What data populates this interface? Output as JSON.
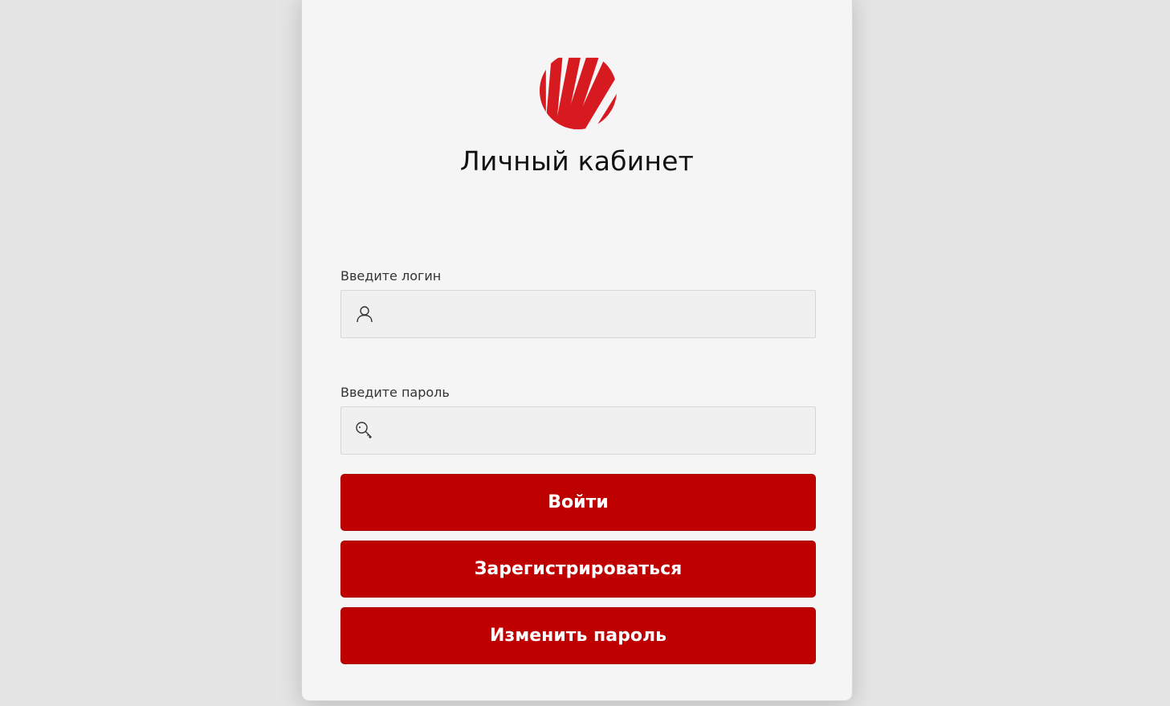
{
  "page": {
    "title": "Личный кабинет"
  },
  "login": {
    "label": "Введите логин",
    "value": "",
    "icon": "user-icon"
  },
  "password": {
    "label": "Введите пароль",
    "value": "",
    "icon": "key-icon"
  },
  "buttons": {
    "login": "Войти",
    "register": "Зарегистрироваться",
    "change_password": "Изменить пароль"
  },
  "colors": {
    "accent": "#bf0000",
    "logo": "#d71920",
    "background": "#e5e5e5",
    "card": "#f5f5f5"
  }
}
